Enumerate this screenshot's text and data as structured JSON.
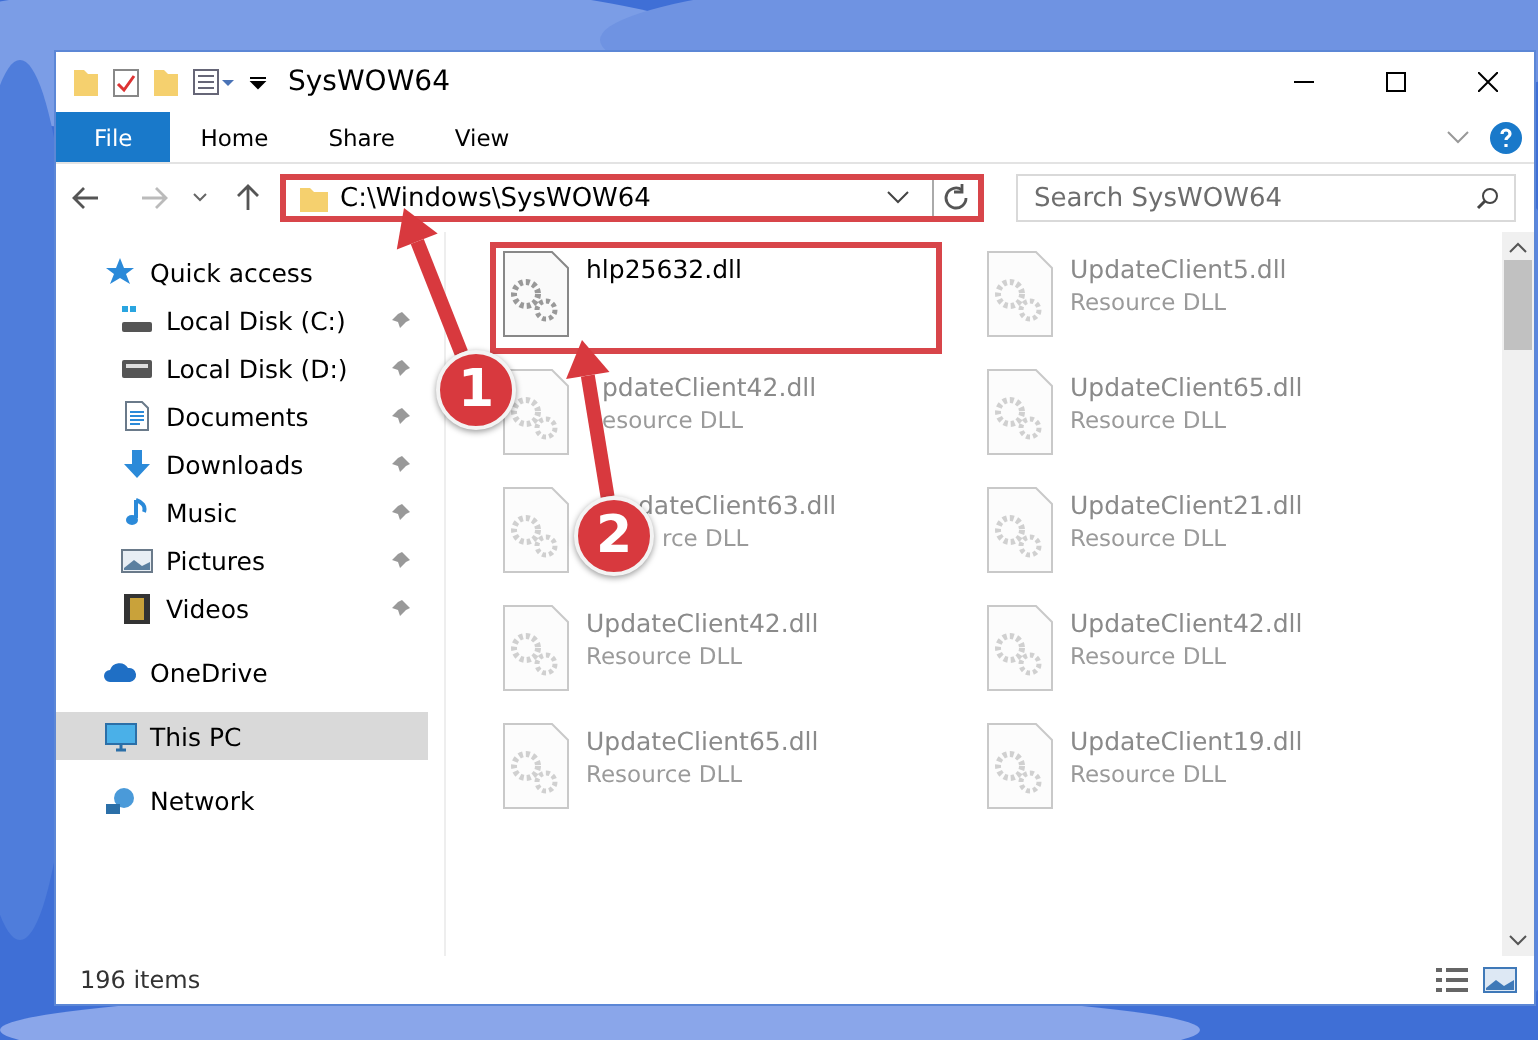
{
  "window": {
    "title": "SysWOW64"
  },
  "ribbon": {
    "tabs": [
      {
        "label": "File",
        "kind": "file",
        "selected": false
      },
      {
        "label": "Home",
        "kind": "tab",
        "selected": false
      },
      {
        "label": "Share",
        "kind": "tab",
        "selected": false
      },
      {
        "label": "View",
        "kind": "tab",
        "selected": false
      }
    ]
  },
  "address": {
    "path": "C:\\Windows\\SysWOW64",
    "highlighted": true
  },
  "search": {
    "placeholder": "Search SysWOW64"
  },
  "nav_pane": {
    "items": [
      {
        "label": "Quick access",
        "kind": "star",
        "selected": false,
        "children": [
          {
            "label": "Local Disk (C:)",
            "kind": "systemdisk",
            "pinned": true,
            "selected": false
          },
          {
            "label": "Local Disk (D:)",
            "kind": "disk",
            "pinned": true,
            "selected": false
          },
          {
            "label": "Documents",
            "kind": "document",
            "pinned": true,
            "selected": false
          },
          {
            "label": "Downloads",
            "kind": "download",
            "pinned": true,
            "selected": false
          },
          {
            "label": "Music",
            "kind": "music",
            "pinned": true,
            "selected": false
          },
          {
            "label": "Pictures",
            "kind": "pictures",
            "pinned": true,
            "selected": false
          },
          {
            "label": "Videos",
            "kind": "videos",
            "pinned": true,
            "selected": false
          }
        ]
      },
      {
        "label": "OneDrive",
        "kind": "cloud",
        "selected": false
      },
      {
        "label": "This PC",
        "kind": "pc",
        "selected": true
      },
      {
        "label": "Network",
        "kind": "network",
        "selected": false
      }
    ]
  },
  "files": [
    {
      "name": "hlp25632.dll",
      "highlighted": true
    },
    {
      "name": "UpdateClient5.dll",
      "type": "Resource DLL",
      "highlighted": false
    },
    {
      "name": "pdateClient42.dll",
      "type": "esource DLL",
      "highlighted": false
    },
    {
      "name": "UpdateClient65.dll",
      "type": "Resource DLL",
      "highlighted": false
    },
    {
      "name": "dateClient63.dll",
      "type": "rce DLL",
      "highlighted": false
    },
    {
      "name": "UpdateClient21.dll",
      "type": "Resource DLL",
      "highlighted": false
    },
    {
      "name": "UpdateClient42.dll",
      "type": "Resource DLL",
      "highlighted": false
    },
    {
      "name": "UpdateClient42.dll",
      "type": "Resource DLL",
      "highlighted": false
    },
    {
      "name": "UpdateClient65.dll",
      "type": "Resource DLL",
      "highlighted": false
    },
    {
      "name": "UpdateClient19.dll",
      "type": "Resource DLL",
      "highlighted": false
    }
  ],
  "status_bar": {
    "count": "196 items"
  },
  "annotations": [
    {
      "label": "1"
    },
    {
      "label": "2"
    }
  ]
}
